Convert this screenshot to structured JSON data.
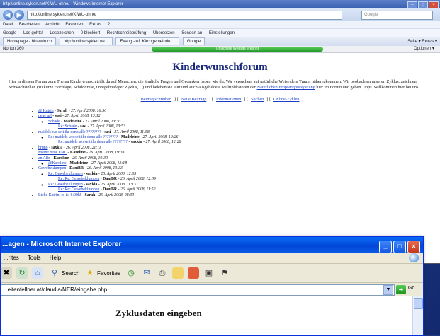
{
  "ie7": {
    "title": "http://online.syklen.net/KIWU-ohne/ - Windows Internet Explorer",
    "address": "http://online.syklen.net/KIWU-ohne/",
    "search_placeholder": "Google",
    "menu": [
      "Datei",
      "Bearbeiten",
      "Ansicht",
      "Favoriten",
      "Extras",
      "?"
    ],
    "toolbar": [
      "Google",
      "Los gehts!",
      "Lesezeichen",
      "0 blockiert",
      "Rechtschreibprüfung",
      "Übersetzen",
      "Senden an",
      "Einstellungen"
    ],
    "tabs": [
      "Homepage - bluewin.ch",
      "http://online.syklen.ne...",
      "Evang.-ref. Kirchgemeinde ...",
      "Google"
    ],
    "tab_tools": "Seite ▾  Extras ▾",
    "norton_label": "Norton 360",
    "norton_status": "Unsichere Website erkannt",
    "norton_options": "Optionen ▾"
  },
  "forum": {
    "title": "Kinderwunschforum",
    "intro_text": "Hier in diesem Forum zum Thema Kinderwunsch trifft du auf Menschen, die ähnliche Fragen und Gedanken haben wie du. Wir versuchen, auf natürliche Weise dem Traum näherzukommen. Wir beobachten unseren Zyklus, zeichnen Schwachstellen (zu kurze Hochlage, Schilddrüse, unregelmäßiger Zyklus, ...) und beleben sie. Oft und auch ausgebildete Multiplikatoren der",
    "intro_link": "Natürlichen Empfängnisregelung",
    "intro_tail": "hier im Forum und geben Tipps. Willkommen hier bei uns!",
    "links": [
      "Beitrag schreiben",
      "Neue Beiträge",
      "Informationen",
      "Suchen",
      "Online-Zyklen"
    ],
    "posts": [
      {
        "subject": "@ Katrin",
        "author": "Sarah",
        "date": "27. April 2008, 16:50",
        "replies": []
      },
      {
        "subject": "neue url",
        "author": "sasi",
        "date": "27. April 2008, 13:12",
        "replies": [
          {
            "subject": "Schade",
            "author": "Madeleine",
            "date": "27. April 2008, 13:30",
            "replies": [
              {
                "subject": "Re: Schade",
                "author": "sasi",
                "date": "27. April 2008, 13:53"
              }
            ]
          }
        ]
      },
      {
        "subject": "maidels wo seit ihr denn alle ????????",
        "author": "sasi",
        "date": "27. April 2008, 11:58",
        "replies": [
          {
            "subject": "Re: maidels wo seit ihr denn alle ????????",
            "author": "Madeleine",
            "date": "27. April 2008, 12:26",
            "replies": [
              {
                "subject": "Re: maidels wo seit ihr denn alle ????????",
                "author": "saxkia",
                "date": "27. April 2008, 12:28"
              }
            ]
          }
        ]
      },
      {
        "subject": "bruno",
        "author": "saxkia",
        "date": "26. April 2008, 21:11",
        "replies": []
      },
      {
        "subject": "Meine neue URL",
        "author": "Karoline",
        "date": "26. April 2008, 19:33",
        "replies": []
      },
      {
        "subject": "an Alle",
        "author": "Karoline",
        "date": "26. April 2008, 19:30",
        "replies": [
          {
            "subject": "@Karoline",
            "author": "Madeleine",
            "date": "27. April 2008, 12:18",
            "replies": []
          }
        ]
      },
      {
        "subject": "Gewebeklumpen",
        "author": "DaniBR",
        "date": "26. April 2008, 10:33",
        "replies": [
          {
            "subject": "Re: Gewebeklumpen",
            "author": "saxkia",
            "date": "26. April 2008, 12:03",
            "replies": [
              {
                "subject": "Re: Re: Gewebeklumpen",
                "author": "DaniBR",
                "date": "26. April 2008, 12:09"
              }
            ]
          },
          {
            "subject": "Re: Gewebeklumpen",
            "author": "saxkia",
            "date": "26. April 2008, 11:13",
            "replies": [
              {
                "subject": "Re: Re: Gewebeklumpen",
                "author": "DaniBR",
                "date": "26. April 2008, 11:52"
              }
            ]
          }
        ]
      },
      {
        "subject": "Liebe Katrin, es ist 8:00h!",
        "author": "Sarah",
        "date": "26. April 2008, 08:00",
        "replies": []
      }
    ]
  },
  "xp": {
    "title": "...agen - Microsoft Internet Explorer",
    "menu": [
      "...rites",
      "Tools",
      "Help"
    ],
    "back_label": "",
    "search_label": "Search",
    "favorites_label": "Favorites",
    "address": "...eitenfellner.at/claudia/NER/eingabe.php",
    "go_label": "Go",
    "page_heading": "Zyklusdaten eingeben"
  }
}
